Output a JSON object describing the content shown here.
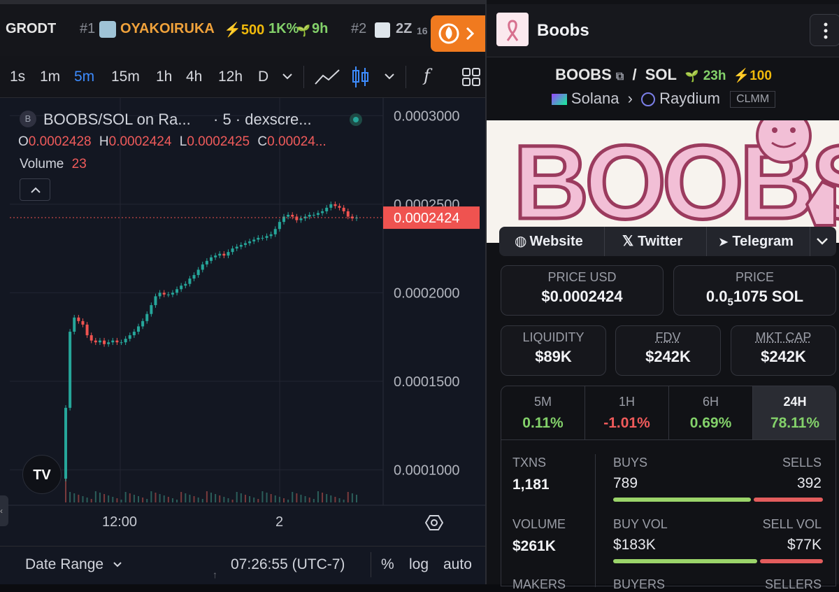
{
  "ticker": {
    "left_symbol": "GRODT",
    "item1_rank": "#1",
    "item1_symbol": "OYAKOIRUKA",
    "item1_boost": "⚡500",
    "item1_change": "1K%",
    "item1_age": "9h",
    "item2_rank": "#2",
    "item2_symbol": "2Z",
    "item2_partial": "16"
  },
  "toolbar": {
    "intervals": [
      "1s",
      "1m",
      "5m",
      "15m",
      "1h",
      "4h",
      "12h",
      "D"
    ],
    "active_interval": "5m",
    "fx_label": "f"
  },
  "chart": {
    "legend_title": "BOOBS/SOL on Ra...",
    "legend_suffix": "· 5 · dexscre...",
    "pair_badge": "B",
    "ohlc": {
      "o_label": "O",
      "o": "0.0002428",
      "h_label": "H",
      "h": "0.0002424",
      "l_label": "L",
      "l": "0.0002425",
      "c_label": "C",
      "c": "0.00024..."
    },
    "volume_label": "Volume",
    "volume_value": "23",
    "price_tag": "0.0002424",
    "x_ticks": [
      "12:00",
      "2"
    ],
    "tv_logo": "TV"
  },
  "chart_data": {
    "type": "candlestick",
    "ylim": [
      8e-05,
      0.00031
    ],
    "y_ticks": [
      "0.0003000",
      "0.0002500",
      "0.0002000",
      "0.0001500",
      "0.0001000"
    ],
    "current_price": 0.0002424,
    "x_labels": [
      "12:00",
      "2"
    ],
    "close_series": [
      0.000135,
      0.000178,
      0.000186,
      0.000184,
      0.000182,
      0.000176,
      0.000173,
      0.000172,
      0.000173,
      0.000171,
      0.000172,
      0.000173,
      0.000172,
      0.000172,
      0.000174,
      0.000176,
      0.000178,
      0.000181,
      0.000184,
      0.000188,
      0.000193,
      0.000198,
      0.0002,
      0.000199,
      0.000199,
      0.0002,
      0.000202,
      0.000204,
      0.000205,
      0.000208,
      0.00021,
      0.000213,
      0.000216,
      0.000218,
      0.00022,
      0.000221,
      0.000222,
      0.000221,
      0.000223,
      0.000225,
      0.000226,
      0.000227,
      0.000228,
      0.000229,
      0.00023,
      0.000231,
      0.000231,
      0.000232,
      0.000233,
      0.000236,
      0.00024,
      0.000243,
      0.000244,
      0.000243,
      0.000241,
      0.000242,
      0.000243,
      0.000244,
      0.000244,
      0.000245,
      0.000246,
      0.000248,
      0.00025,
      0.000249,
      0.000248,
      0.000246,
      0.000243,
      0.000242,
      0.0002424
    ]
  },
  "bottom": {
    "date_range": "Date Range",
    "time": "07:26:55 (UTC-7)",
    "pct": "%",
    "log": "log",
    "auto": "auto"
  },
  "panel": {
    "name": "Boobs",
    "base": "BOOBS",
    "sep": "/",
    "quote": "SOL",
    "age": "23h",
    "boost": "⚡100",
    "chain": "Solana",
    "dex": "Raydium",
    "dex_type": "CLMM",
    "banner_text": "BOOBS",
    "links": {
      "website": "Website",
      "twitter": "Twitter",
      "telegram": "Telegram"
    },
    "price_usd_label": "PRICE USD",
    "price_usd": "$0.0002424",
    "price_label": "PRICE",
    "price_sol_prefix": "0.0",
    "price_sol_sub": "5",
    "price_sol_rest": "1075 SOL",
    "liquidity_label": "LIQUIDITY",
    "liquidity": "$89K",
    "fdv_label": "FDV",
    "fdv": "$242K",
    "mcap_label": "MKT CAP",
    "mcap": "$242K",
    "changes": [
      {
        "label": "5M",
        "value": "0.11%"
      },
      {
        "label": "1H",
        "value": "-1.01%"
      },
      {
        "label": "6H",
        "value": "0.69%"
      },
      {
        "label": "24H",
        "value": "78.11%"
      }
    ],
    "txns_label": "TXNS",
    "txns": "1,181",
    "buys_label": "BUYS",
    "buys": "789",
    "sells_label": "SELLS",
    "sells": "392",
    "volume_label": "VOLUME",
    "volume": "$261K",
    "buy_vol_label": "BUY VOL",
    "buy_vol": "$183K",
    "sell_vol_label": "SELL VOL",
    "sell_vol": "$77K",
    "makers_label": "MAKERS",
    "buyers_label": "BUYERS",
    "sellers_label": "SELLERS",
    "buy_ratio": 0.67,
    "buy_vol_ratio": 0.7
  },
  "colors": {
    "up": "#26a69a",
    "down": "#ef5350",
    "accent": "#3d8bfd",
    "green": "#83d16a",
    "red": "#f05b5b"
  }
}
